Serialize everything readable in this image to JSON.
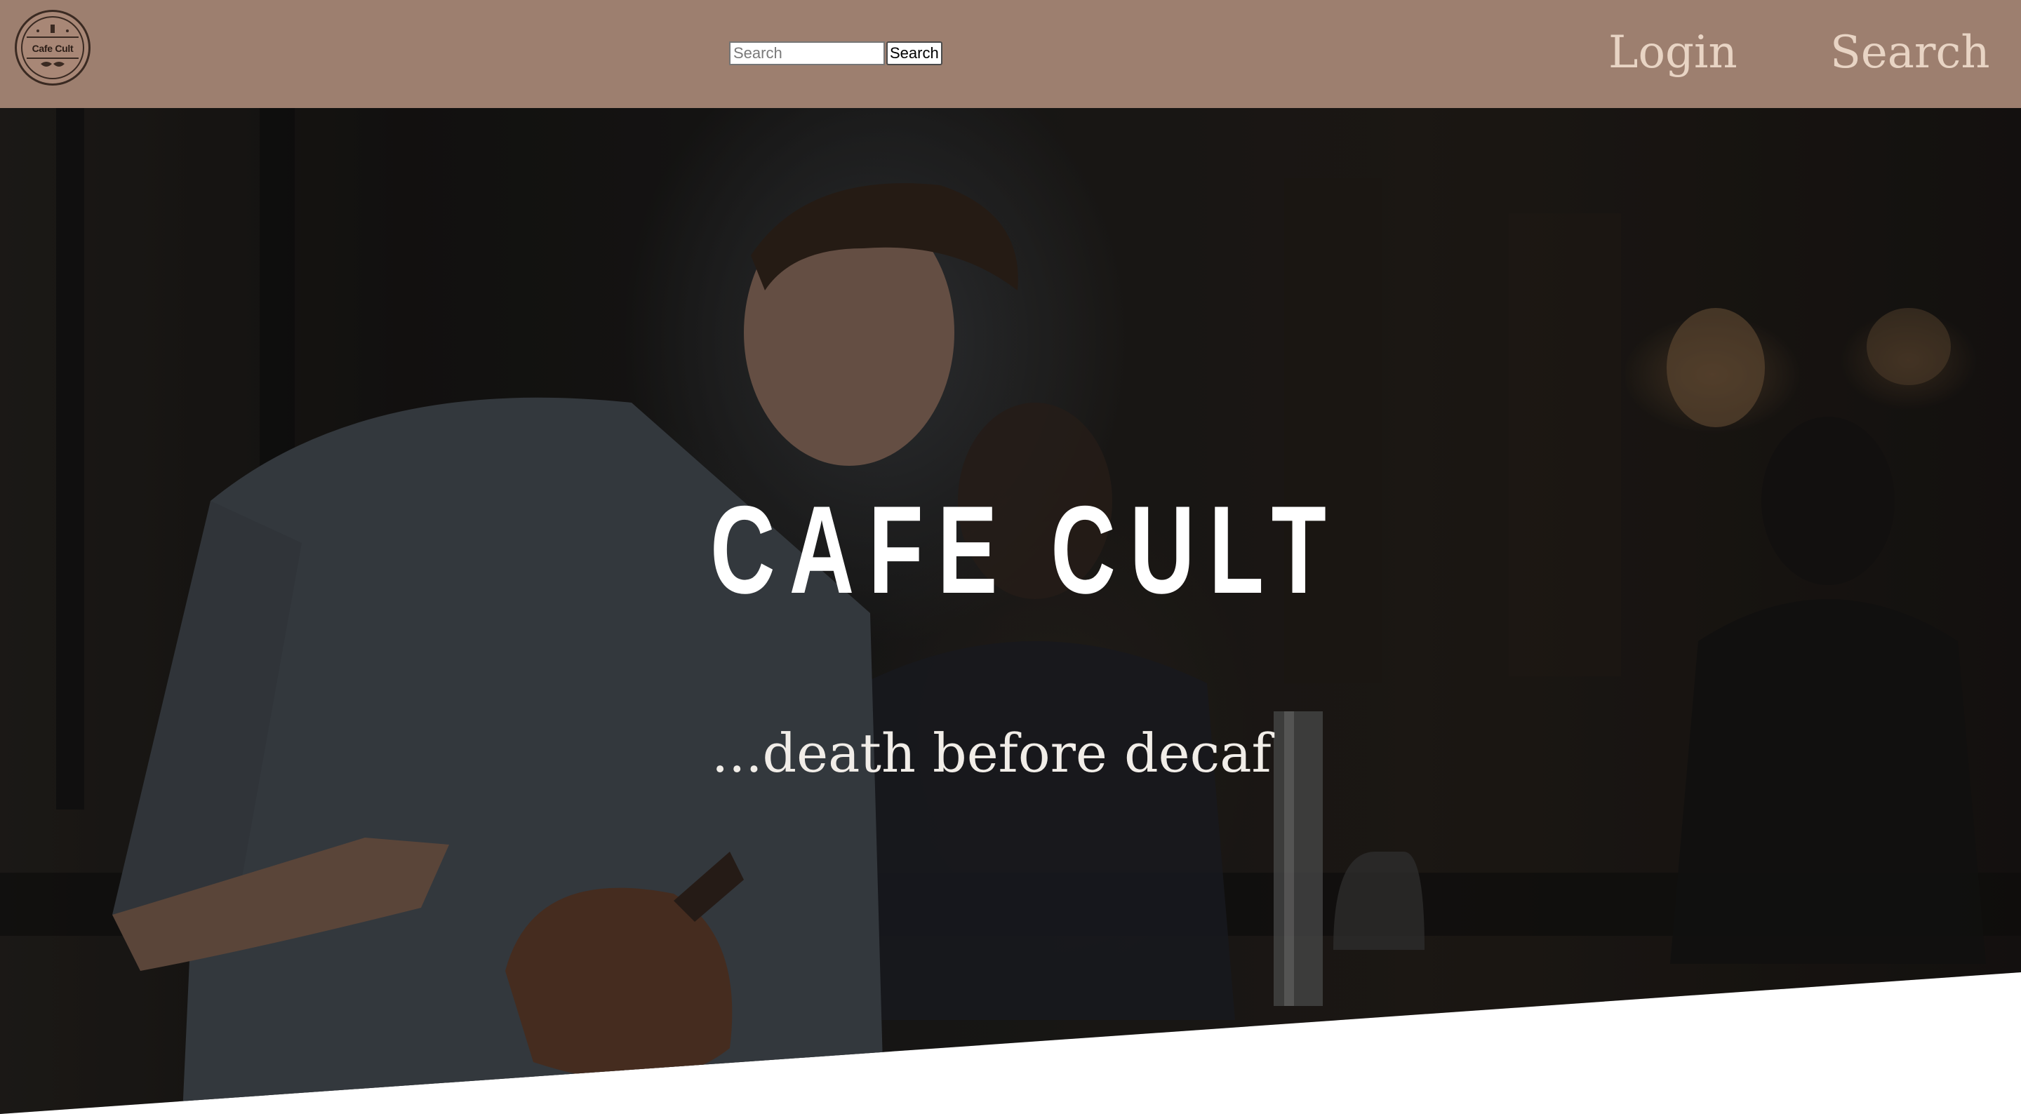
{
  "header": {
    "logo_text": "Cafe Cult",
    "search": {
      "placeholder": "Search",
      "value": "",
      "button_label": "Search"
    },
    "nav": {
      "login_label": "Login",
      "search_label": "Search"
    }
  },
  "hero": {
    "title": "CAFE CULT",
    "tagline": "...death before decaf"
  },
  "colors": {
    "header_bg": "#9d7f6f",
    "nav_text": "#e8d4c4",
    "hero_text": "#ffffff",
    "page_bg": "#ffffff"
  }
}
